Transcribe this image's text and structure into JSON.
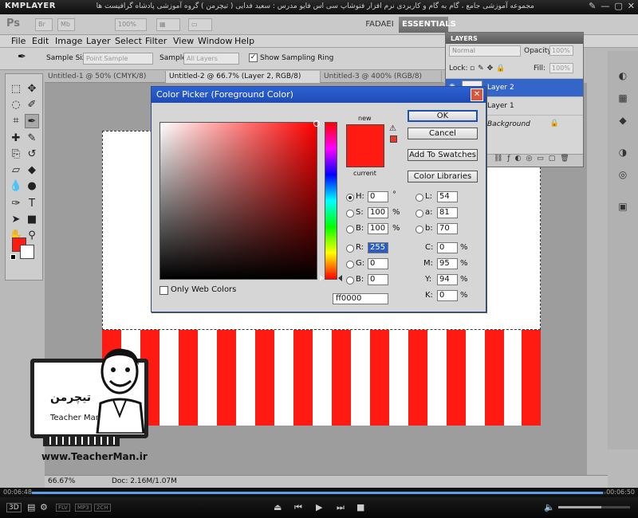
{
  "player": {
    "logo": "KMPLAYER",
    "caption": "مجموعه آموزشی جامع ، گام به گام و کاربردی نرم افزار فتوشاپ سی اس فایو  مدرس : سعید فدایی ( تیچرمن ) گروه آموزشی پادشاه گرافیست ها",
    "elapsed": "00:06:48",
    "total": "00:06:50",
    "progress": 0.995,
    "volume": 0.6,
    "tags": [
      "FLV",
      "MP3",
      "2CH"
    ],
    "btn_3d": "3D"
  },
  "photoshop": {
    "logo": "Ps",
    "zoom_box": "100%",
    "workspace_user": "FADAEI",
    "workspace": "ESSENTIALS",
    "menu": [
      "File",
      "Edit",
      "Image",
      "Layer",
      "Select",
      "Filter",
      "View",
      "Window",
      "Help"
    ],
    "options": {
      "sample_size_label": "Sample Size:",
      "sample_size_value": "Point Sample",
      "sample_label": "Sample:",
      "sample_value": "All Layers",
      "show_ring_label": "Show Sampling Ring",
      "show_ring_checked": "✓"
    },
    "tabs": [
      "Untitled-1 @ 50% (CMYK/8)",
      "Untitled-2 @ 66.7% (Layer 2, RGB/8)",
      "Untitled-3 @ 400% (RGB/8)"
    ],
    "status": {
      "zoom": "66.67%",
      "doc": "Doc: 2.16M/1.07M"
    },
    "layers": {
      "title": "LAYERS",
      "blend": "Normal",
      "opacity_label": "Opacity:",
      "opacity": "100%",
      "lock_label": "Lock:",
      "fill_label": "Fill:",
      "fill": "100%",
      "items": [
        {
          "name": "Layer 2",
          "selected": true
        },
        {
          "name": "Layer 1",
          "selected": false
        },
        {
          "name": "Background",
          "selected": false
        }
      ]
    }
  },
  "color_picker": {
    "title": "Color Picker (Foreground Color)",
    "new_label": "new",
    "current_label": "current",
    "ok": "OK",
    "cancel": "Cancel",
    "add_swatches": "Add To Swatches",
    "color_libraries": "Color Libraries",
    "only_web": "Only Web Colors",
    "hsb": {
      "h_label": "H:",
      "h": "0",
      "h_unit": "°",
      "s_label": "S:",
      "s": "100",
      "s_unit": "%",
      "b_label": "B:",
      "b": "100",
      "b_unit": "%"
    },
    "rgb": {
      "r_label": "R:",
      "r": "255",
      "g_label": "G:",
      "g": "0",
      "b_label": "B:",
      "b": "0"
    },
    "lab": {
      "l_label": "L:",
      "l": "54",
      "a_label": "a:",
      "a": "81",
      "b_label": "b:",
      "b": "70"
    },
    "cmyk": {
      "c_label": "C:",
      "c": "0",
      "m_label": "M:",
      "m": "95",
      "y_label": "Y:",
      "y": "94",
      "k_label": "K:",
      "k": "0",
      "unit": "%"
    },
    "hex_label": "#",
    "hex": "ff0000",
    "new_color": "#ff1a12"
  },
  "watermark": {
    "logo_fa": "تیچرمن",
    "logo_en": "Teacher Man",
    "url": "www.TeacherMan.ir"
  }
}
